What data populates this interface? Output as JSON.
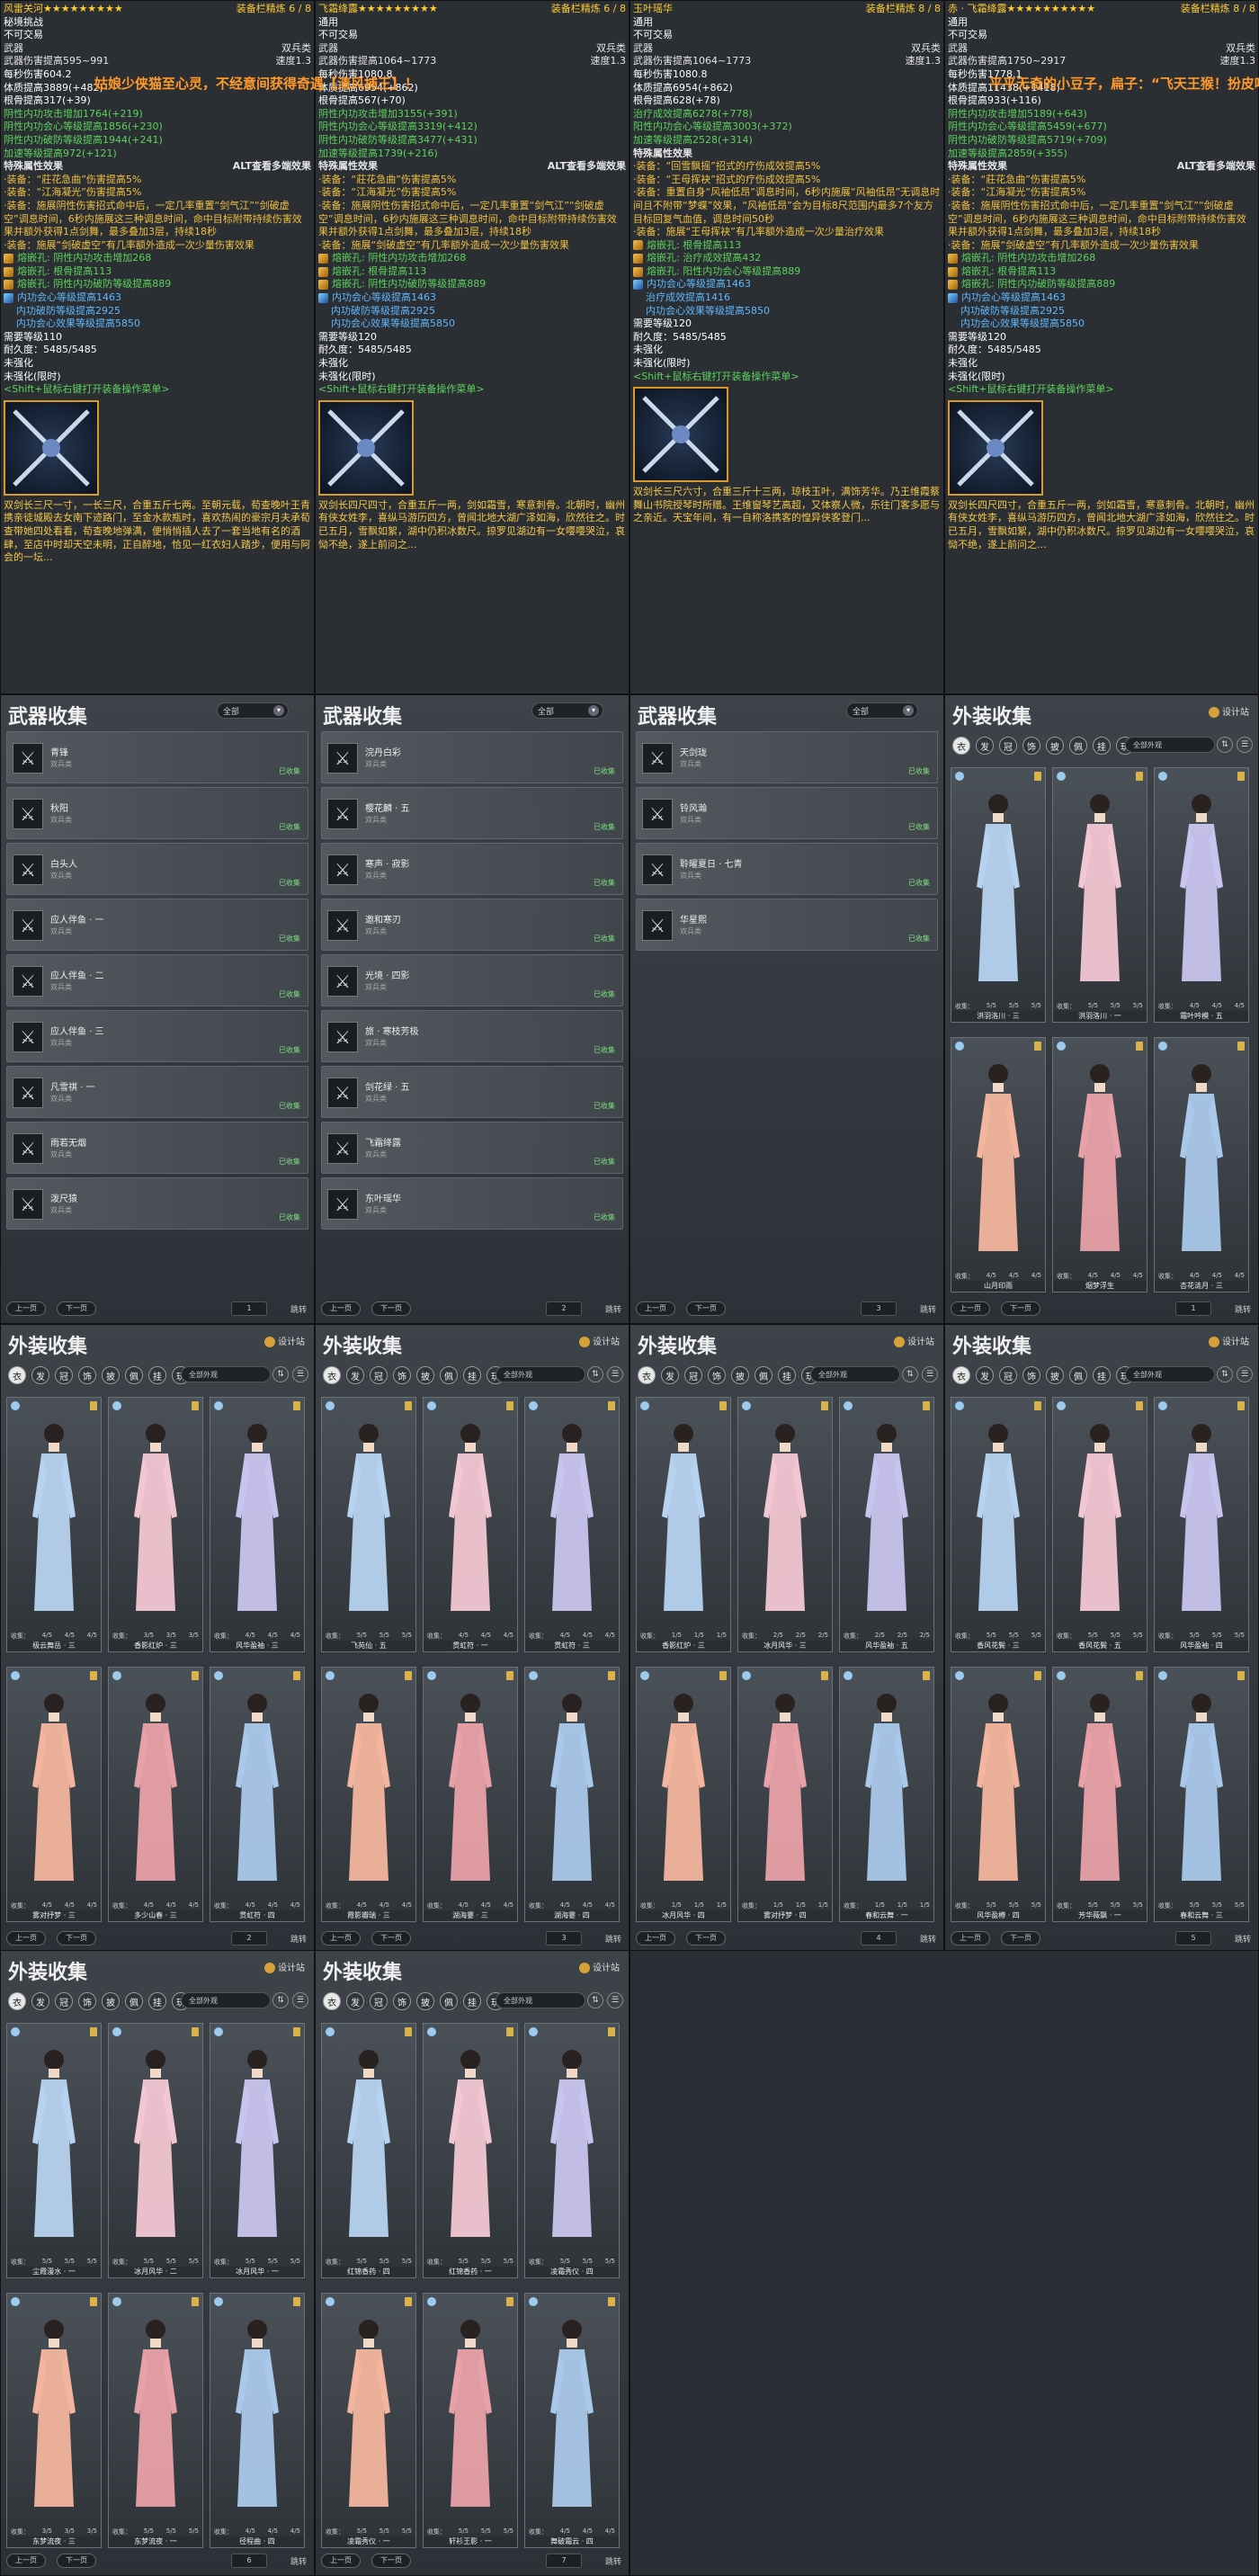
{
  "tooltips": [
    {
      "title": "风雷关河",
      "stars": "★★★★★★★★★",
      "refine": "装备栏精炼 6 / 8",
      "bind": "秘境挑战",
      "trade": "不可交易",
      "type_left": "武器",
      "type_right": "双兵类",
      "speed": "速度1.3",
      "dmg": "武器伤害提高595~991",
      "dps": "每秒伤害604.2",
      "stat1": "体质提高3889(+482)",
      "stat2": "根骨提高317(+39)",
      "g1": "阴性内功攻击增加1764(+219)",
      "g2": "阴性内功会心等级提高1856(+230)",
      "g3": "阴性内功破防等级提高1944(+241)",
      "g4": "加速等级提高972(+121)",
      "special": "特殊属性效果",
      "alt": "ALT查看多端效果",
      "e1": "·装备：“莊花急曲”伤害提高5%",
      "e2": "·装备：“江海凝光”伤害提高5%",
      "e3": "·装备：施展阴性伤害招式命中后，一定几率重置“剑气江”“剑破虚空”调息时间，6秒内施展这三种调息时间，命中目标附带持续伤害效果并额外获得1点剑舞，最多叠加3层，持续18秒",
      "e4": "·装备：施展“剑破虚空”有几率额外造成一次少量伤害效果",
      "s1": "熔嵌孔: 阴性内功攻击增加268",
      "s2": "熔嵌孔: 根骨提高113",
      "s3": "熔嵌孔: 阴性内功破防等级提高889",
      "s4": "内功会心等级提高1463",
      "s5": "内功破防等级提高2925",
      "s6": "内功会心效果等级提高5850",
      "req": "需要等级110",
      "dur": "耐久度：5485/5485",
      "un1": "未强化",
      "un2": "未强化(限时)",
      "shift": "<Shift+鼠标右键打开装备操作菜单>",
      "lore": "双剑长三尺一寸，一长三尺，合重五斤七两。至朝元载，荀查晚叶王青携亲徒城殿去女南下迹路门，至金水款瓶时，喜欢热闹的豪宗月夫承荀查带她四处看看，荀查晚地弹满，便悄悄插人去了一套当地有名的酒肆，至店中时却天空未明，正自醉地，恰见一红衣妇人踏步，便用与阿会的一坛..."
    },
    {
      "title": "飞霜绛露",
      "stars": "★★★★★★★★★",
      "refine": "装备栏精炼 6 / 8",
      "bind": "通用",
      "trade": "不可交易",
      "type_left": "武器",
      "type_right": "双兵类",
      "speed": "速度1.3",
      "dmg": "武器伤害提高1064~1773",
      "dps": "每秒伤害1080.8",
      "stat1": "体质提高6954(+862)",
      "stat2": "根骨提高567(+70)",
      "g1": "阴性内功攻击增加3155(+391)",
      "g2": "阴性内功会心等级提高3319(+412)",
      "g3": "阴性内功破防等级提高3477(+431)",
      "g4": "加速等级提高1739(+216)",
      "special": "特殊属性效果",
      "alt": "ALT查看多端效果",
      "e1": "·装备：“莊花急曲”伤害提高5%",
      "e2": "·装备：“江海凝光”伤害提高5%",
      "e3": "·装备：施展阴性伤害招式命中后，一定几率重置“剑气江”“剑破虚空”调息时间，6秒内施展这三种调息时间，命中目标附带持续伤害效果并额外获得1点剑舞，最多叠加3层，持续18秒",
      "e4": "·装备：施展“剑破虚空”有几率额外造成一次少量伤害效果",
      "s1": "熔嵌孔: 阴性内功攻击增加268",
      "s2": "熔嵌孔: 根骨提高113",
      "s3": "熔嵌孔: 阴性内功破防等级提高889",
      "s4": "内功会心等级提高1463",
      "s5": "内功破防等级提高2925",
      "s6": "内功会心效果等级提高5850",
      "req": "需要等级120",
      "dur": "耐久度：5485/5485",
      "un1": "未强化",
      "un2": "未强化(限时)",
      "shift": "<Shift+鼠标右键打开装备操作菜单>",
      "lore": "双剑长四尺四寸，合重五斤一两，剑如霜雪，寒意刺骨。北朝时，幽州有侠女姓李，喜纵马游历四方，曾闻北地大湖广泽如海，欣然往之。时已五月，雪飘如絮，湖中仍积冰数尺。掠罗见湖边有一女嘤嘤哭泣，哀恸不绝，遂上前问之..."
    },
    {
      "title": "玉叶瑶华",
      "stars": "",
      "refine": "装备栏精炼 8 / 8",
      "bind": "通用",
      "trade": "不可交易",
      "type_left": "武器",
      "type_right": "双兵类",
      "speed": "速度1.3",
      "dmg": "武器伤害提高1064~1773",
      "dps": "每秒伤害1080.8",
      "stat1": "体质提高6954(+862)",
      "stat2": "根骨提高628(+78)",
      "g1": "治疗成效提高6278(+778)",
      "g2": "阳性内功会心等级提高3003(+372)",
      "g3": "加速等级提高2528(+314)",
      "g4": "",
      "special": "特殊属性效果",
      "alt": "",
      "e1": "·装备：“回雪飘摇”招式的疗伤成效提高5%",
      "e2": "·装备：“王母挥袂”招式的疗伤成效提高5%",
      "e3": "·装备：重置自身“风袖低昂”调息时间，6秒内施展“风袖低昂”无调息时间且不附带“梦蝶”效果，“风袖低昂”会为目标8尺范围内最多7个友方目标回复气血值，调息时间50秒",
      "e4": "·装备：施展“王母挥袂”有几率额外造成一次少量治疗效果",
      "s1": "熔嵌孔: 根骨提高113",
      "s2": "熔嵌孔: 治疗成效提高432",
      "s3": "熔嵌孔: 阳性内功会心等级提高889",
      "s4": "内功会心等级提高1463",
      "s5": "治疗成效提高1416",
      "s6": "内功会心效果等级提高5850",
      "req": "需要等级120",
      "dur": "耐久度：5485/5485",
      "un1": "未强化",
      "un2": "未强化(限时)",
      "shift": "<Shift+鼠标右键打开装备操作菜单>",
      "lore": "双剑长三尺六寸，合重三斤十三两，琼枝玉叶，满饰芳华。乃王维霞蔡舞山书院授琴时所赠。王维窗琴艺高超，又体察人微，乐往门客多愿与之亲近。天宝年间，有一自称洛携客的惶异侠客登门..."
    },
    {
      "title": "赤 · 飞霜绛露",
      "stars": "★★★★★★★★★★",
      "refine": "装备栏精炼 8 / 8",
      "bind": "通用",
      "trade": "不可交易",
      "type_left": "武器",
      "type_right": "双兵类",
      "speed": "速度1.3",
      "dmg": "武器伤害提高1750~2917",
      "dps": "每秒伤害1778.1",
      "stat1": "体质提高11438(+1418)",
      "stat2": "根骨提高933(+116)",
      "g1": "阴性内功攻击增加5189(+643)",
      "g2": "阴性内功会心等级提高5459(+677)",
      "g3": "阴性内功破防等级提高5719(+709)",
      "g4": "加速等级提高2859(+355)",
      "special": "特殊属性效果",
      "alt": "ALT查看多端效果",
      "e1": "·装备：“莊花急曲”伤害提高5%",
      "e2": "·装备：“江海凝光”伤害提高5%",
      "e3": "·装备：施展阴性伤害招式命中后，一定几率重置“剑气江”“剑破虚空”调息时间，6秒内施展这三种调息时间，命中目标附带持续伤害效果并额外获得1点剑舞，最多叠加3层，持续18秒",
      "e4": "·装备：施展“剑破虚空”有几率额外造成一次少量伤害效果",
      "s1": "熔嵌孔: 阴性内功攻击增加268",
      "s2": "熔嵌孔: 根骨提高113",
      "s3": "熔嵌孔: 阴性内功破防等级提高889",
      "s4": "内功会心等级提高1463",
      "s5": "内功破防等级提高2925",
      "s6": "内功会心效果等级提高5850",
      "req": "需要等级120",
      "dur": "耐久度：5485/5485",
      "un1": "未强化",
      "un2": "未强化(限时)",
      "shift": "<Shift+鼠标右键打开装备操作菜单>",
      "lore": "双剑长四尺四寸，合重五斤一两，剑如霜雪，寒意刺骨。北朝时，幽州有侠女姓李，喜纵马游历四方，曾闻北地大湖广泽如海，欣然往之。时已五月，雪飘如絮，湖中仍积冰数尺。掠罗见湖边有一女嘤嘤哭泣，哀恸不绝，遂上前问之..."
    }
  ],
  "banners": {
    "b1": "姑娘少侠猫至心灵，不经意间获得奇遇【清风捕王】！",
    "b2": "平平无奇的小豆子，扁子：“飞天王猴！扮皮喵在长安对姜棠使用"
  },
  "weapon_panels": [
    {
      "title": "武器收集",
      "filter": "全部",
      "page": "1",
      "items": [
        {
          "name": "青锋",
          "sub": "双兵类",
          "stat": "已收集"
        },
        {
          "name": "秋阳",
          "sub": "双兵类",
          "stat": "已收集"
        },
        {
          "name": "白头人",
          "sub": "双兵类",
          "stat": "已收集"
        },
        {
          "name": "应人伴鱼 · 一",
          "sub": "双兵类",
          "stat": "已收集"
        },
        {
          "name": "应人伴鱼 · 二",
          "sub": "双兵类",
          "stat": "已收集"
        },
        {
          "name": "应人伴鱼 · 三",
          "sub": "双兵类",
          "stat": "已收集"
        },
        {
          "name": "凡雪祺 · 一",
          "sub": "双兵类",
          "stat": "已收集"
        },
        {
          "name": "雨若无烟",
          "sub": "双兵类",
          "stat": "已收集"
        },
        {
          "name": "泼尺猿",
          "sub": "双兵类",
          "stat": "已收集"
        }
      ]
    },
    {
      "title": "武器收集",
      "filter": "全部",
      "page": "2",
      "items": [
        {
          "name": "浣丹白彩",
          "sub": "双兵类",
          "stat": "已收集"
        },
        {
          "name": "樱花麟 · 五",
          "sub": "双兵类",
          "stat": "已收集"
        },
        {
          "name": "寒声 · 寂影",
          "sub": "双兵类",
          "stat": "已收集"
        },
        {
          "name": "邀和寒刃",
          "sub": "双兵类",
          "stat": "已收集"
        },
        {
          "name": "光境 · 四影",
          "sub": "双兵类",
          "stat": "已收集"
        },
        {
          "name": "旅 · 寒枝芳极",
          "sub": "双兵类",
          "stat": "已收集"
        },
        {
          "name": "剑花绿 · 五",
          "sub": "双兵类",
          "stat": "已收集"
        },
        {
          "name": "飞霜绛露",
          "sub": "双兵类",
          "stat": "已收集"
        },
        {
          "name": "东叶瑶华",
          "sub": "双兵类",
          "stat": "已收集"
        }
      ]
    },
    {
      "title": "武器收集",
      "filter": "全部",
      "page": "3",
      "items": [
        {
          "name": "天剑珑",
          "sub": "双兵类",
          "stat": "已收集"
        },
        {
          "name": "铃风瀚",
          "sub": "双兵类",
          "stat": "已收集"
        },
        {
          "name": "聆曜夏日 · 七青",
          "sub": "双兵类",
          "stat": "已收集"
        },
        {
          "name": "华星熙",
          "sub": "双兵类",
          "stat": "已收集"
        }
      ]
    }
  ],
  "outfit_common": {
    "title": "外装收集",
    "design": "设计站",
    "filter": "全部外观",
    "prev": "上一页",
    "next": "下一页",
    "jump": "跳转",
    "collect": "收集：",
    "tabs": [
      "衣",
      "发",
      "冠",
      "饰",
      "披",
      "佩",
      "挂",
      "玩"
    ]
  },
  "outfit_panels": [
    {
      "page": "1",
      "cards": [
        {
          "name": "洪羽洛川 · 三",
          "c1": "5/5",
          "c2": "5/5",
          "c3": "5/5"
        },
        {
          "name": "洪羽洛川 · 一",
          "c1": "5/5",
          "c2": "5/5",
          "c3": "5/5"
        },
        {
          "name": "霜叶吟模 · 五",
          "c1": "4/5",
          "c2": "4/5",
          "c3": "4/5"
        },
        {
          "name": "山月印雨",
          "c1": "4/5",
          "c2": "4/5",
          "c3": "4/5"
        },
        {
          "name": "烟梦浮生",
          "c1": "4/5",
          "c2": "4/5",
          "c3": "4/5"
        },
        {
          "name": "杏花涟月 · 三",
          "c1": "4/5",
          "c2": "4/5",
          "c3": "4/5"
        }
      ]
    },
    {
      "page": "2",
      "cards": [
        {
          "name": "极云舞岳 · 三",
          "c1": "4/5",
          "c2": "4/5",
          "c3": "4/5"
        },
        {
          "name": "香影红炉 · 三",
          "c1": "3/5",
          "c2": "3/5",
          "c3": "3/5"
        },
        {
          "name": "风华盈袖 · 三",
          "c1": "4/5",
          "c2": "4/5",
          "c3": "4/5"
        },
        {
          "name": "雾对抒梦 · 三",
          "c1": "4/5",
          "c2": "4/5",
          "c3": "4/5"
        },
        {
          "name": "多少山春 · 三",
          "c1": "4/5",
          "c2": "4/5",
          "c3": "4/5"
        },
        {
          "name": "贯虹符 · 四",
          "c1": "4/5",
          "c2": "4/5",
          "c3": "4/5"
        }
      ]
    },
    {
      "page": "3",
      "cards": [
        {
          "name": "飞苑仙 · 五",
          "c1": "5/5",
          "c2": "5/5",
          "c3": "5/5"
        },
        {
          "name": "贯虹符 · 一",
          "c1": "4/5",
          "c2": "4/5",
          "c3": "4/5"
        },
        {
          "name": "贯虹符 · 三",
          "c1": "4/5",
          "c2": "4/5",
          "c3": "4/5"
        },
        {
          "name": "霞影瓣瑞 · 三",
          "c1": "4/5",
          "c2": "4/5",
          "c3": "4/5"
        },
        {
          "name": "湖海霎 · 三",
          "c1": "4/5",
          "c2": "4/5",
          "c3": "4/5"
        },
        {
          "name": "湖海霎 · 四",
          "c1": "4/5",
          "c2": "4/5",
          "c3": "4/5"
        }
      ]
    },
    {
      "page": "4",
      "cards": [
        {
          "name": "香影红炉 · 三",
          "c1": "1/5",
          "c2": "1/5",
          "c3": "1/5"
        },
        {
          "name": "冰月风华 · 三",
          "c1": "2/5",
          "c2": "2/5",
          "c3": "2/5"
        },
        {
          "name": "风华盈袖 · 五",
          "c1": "2/5",
          "c2": "2/5",
          "c3": "2/5"
        },
        {
          "name": "冰月风华 · 四",
          "c1": "1/5",
          "c2": "1/5",
          "c3": "1/5"
        },
        {
          "name": "雾对抒梦 · 四",
          "c1": "1/5",
          "c2": "1/5",
          "c3": "1/5"
        },
        {
          "name": "春和云舞 · 一",
          "c1": "1/5",
          "c2": "1/5",
          "c3": "1/5"
        }
      ]
    },
    {
      "page": "5",
      "cards": [
        {
          "name": "香风花鬓 · 三",
          "c1": "5/5",
          "c2": "5/5",
          "c3": "5/5"
        },
        {
          "name": "香风花鬓 · 五",
          "c1": "5/5",
          "c2": "5/5",
          "c3": "5/5"
        },
        {
          "name": "风华盈袖 · 四",
          "c1": "5/5",
          "c2": "5/5",
          "c3": "5/5"
        },
        {
          "name": "风华盈樽 · 四",
          "c1": "5/5",
          "c2": "5/5",
          "c3": "5/5"
        },
        {
          "name": "芳华薇飘 · 一",
          "c1": "5/5",
          "c2": "5/5",
          "c3": "5/5"
        },
        {
          "name": "春和云舞 · 三",
          "c1": "5/5",
          "c2": "5/5",
          "c3": "5/5"
        }
      ]
    },
    {
      "page": "6",
      "cards": [
        {
          "name": "尘霞漫水 · 一",
          "c1": "5/5",
          "c2": "5/5",
          "c3": "5/5"
        },
        {
          "name": "冰月风华 · 二",
          "c1": "5/5",
          "c2": "5/5",
          "c3": "5/5"
        },
        {
          "name": "冰月风华 · 一",
          "c1": "5/5",
          "c2": "5/5",
          "c3": "5/5"
        },
        {
          "name": "东梦流夜 · 三",
          "c1": "3/5",
          "c2": "3/5",
          "c3": "3/5"
        },
        {
          "name": "东梦流夜 · 一",
          "c1": "5/5",
          "c2": "5/5",
          "c3": "5/5"
        },
        {
          "name": "径程曲 · 四",
          "c1": "4/5",
          "c2": "4/5",
          "c3": "4/5"
        }
      ]
    },
    {
      "page": "7",
      "cards": [
        {
          "name": "红锦香药 · 四",
          "c1": "5/5",
          "c2": "5/5",
          "c3": "5/5"
        },
        {
          "name": "红锦香药 · 一",
          "c1": "5/5",
          "c2": "5/5",
          "c3": "5/5"
        },
        {
          "name": "凌霜秀仪 · 四",
          "c1": "5/5",
          "c2": "5/5",
          "c3": "5/5"
        },
        {
          "name": "凌霜秀仪 · 一",
          "c1": "5/5",
          "c2": "5/5",
          "c3": "5/5"
        },
        {
          "name": "轩衫王影 · 一",
          "c1": "5/5",
          "c2": "5/5",
          "c3": "5/5"
        },
        {
          "name": "舞破霜云 · 四",
          "c1": "4/5",
          "c2": "4/5",
          "c3": "4/5"
        }
      ]
    }
  ],
  "colors": {
    "tooltip_bg": "#2b2f33",
    "panel_bg": "#3d4349",
    "gold": "#ffcc33",
    "green": "#5cd35c",
    "orange": "#ff9a2a"
  }
}
